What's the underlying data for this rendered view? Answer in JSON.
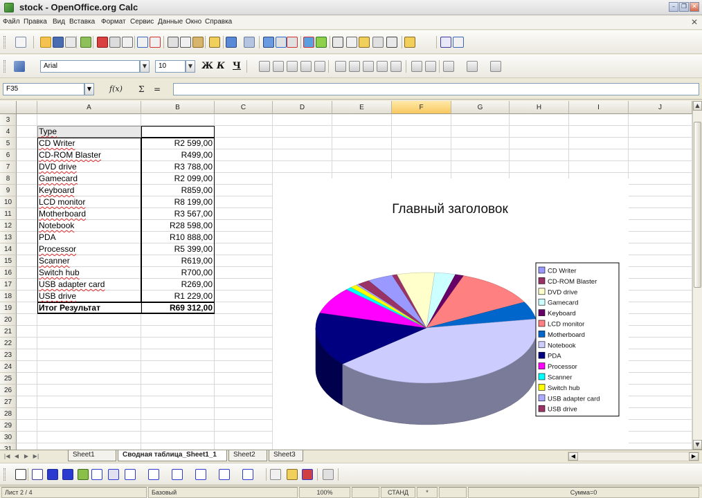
{
  "window": {
    "title": "stock - OpenOffice.org Calc"
  },
  "menubar": {
    "items": [
      "Файл",
      "Правка",
      "Вид",
      "Вставка",
      "Формат",
      "Сервис",
      "Данные",
      "Окно",
      "Справка"
    ]
  },
  "format_toolbar": {
    "font_name": "Arial",
    "font_size": "10",
    "bold_label": "Ж",
    "italic_label": "К",
    "underline_label": "Ч"
  },
  "formula_bar": {
    "cell_ref": "F35",
    "fx_label": "f(x)",
    "sum_label": "Σ",
    "equals_label": "=",
    "value": ""
  },
  "grid": {
    "columns": [
      "A",
      "B",
      "C",
      "D",
      "E",
      "F",
      "G",
      "H",
      "I",
      "J"
    ],
    "active_column": "F",
    "rows": [
      "3",
      "4",
      "5",
      "6",
      "7",
      "8",
      "9",
      "10",
      "11",
      "12",
      "13",
      "14",
      "15",
      "16",
      "17",
      "18",
      "19",
      "20",
      "21",
      "22",
      "23",
      "24",
      "25",
      "26",
      "27",
      "28",
      "29",
      "30",
      "31"
    ]
  },
  "pivot": {
    "header": "Type",
    "items": [
      {
        "type": "CD Writer",
        "value": "R2 599,00"
      },
      {
        "type": "CD-ROM Blaster",
        "value": "R499,00"
      },
      {
        "type": "DVD drive",
        "value": "R3 788,00"
      },
      {
        "type": "Gamecard",
        "value": "R2 099,00"
      },
      {
        "type": "Keyboard",
        "value": "R859,00"
      },
      {
        "type": "LCD monitor",
        "value": "R8 199,00"
      },
      {
        "type": "Motherboard",
        "value": "R3 567,00"
      },
      {
        "type": "Notebook",
        "value": "R28 598,00"
      },
      {
        "type": "PDA",
        "value": "R10 888,00"
      },
      {
        "type": "Processor",
        "value": "R5 399,00"
      },
      {
        "type": "Scanner",
        "value": "R619,00"
      },
      {
        "type": "Switch hub",
        "value": "R700,00"
      },
      {
        "type": "USB adapter card",
        "value": "R269,00"
      },
      {
        "type": "USB drive",
        "value": "R1 229,00"
      }
    ],
    "total_label": "Итог Результат",
    "total_value": "R69 312,00"
  },
  "chart_data": {
    "type": "pie",
    "title": "Главный заголовок",
    "legend_position": "right",
    "categories": [
      "CD Writer",
      "CD-ROM Blaster",
      "DVD drive",
      "Gamecard",
      "Keyboard",
      "LCD monitor",
      "Motherboard",
      "Notebook",
      "PDA",
      "Processor",
      "Scanner",
      "Switch hub",
      "USB adapter card",
      "USB drive"
    ],
    "values": [
      2599,
      499,
      3788,
      2099,
      859,
      8199,
      3567,
      28598,
      10888,
      5399,
      619,
      700,
      269,
      1229
    ],
    "colors": [
      "#9999ff",
      "#993366",
      "#ffffcc",
      "#ccffff",
      "#660066",
      "#ff8080",
      "#0066cc",
      "#ccccff",
      "#000080",
      "#ff00ff",
      "#00ffff",
      "#ffff00",
      "#aaaaff",
      "#993366"
    ]
  },
  "sheet_tabs": {
    "tabs": [
      "Sheet1",
      "Сводная таблица_Sheet1_1",
      "Sheet2",
      "Sheet3"
    ],
    "active": "Сводная таблица_Sheet1_1"
  },
  "statusbar": {
    "sheet": "Лист 2 / 4",
    "style": "Базовый",
    "zoom": "100%",
    "mode": "СТАНД",
    "modified": "*",
    "sum": "Сумма=0"
  }
}
